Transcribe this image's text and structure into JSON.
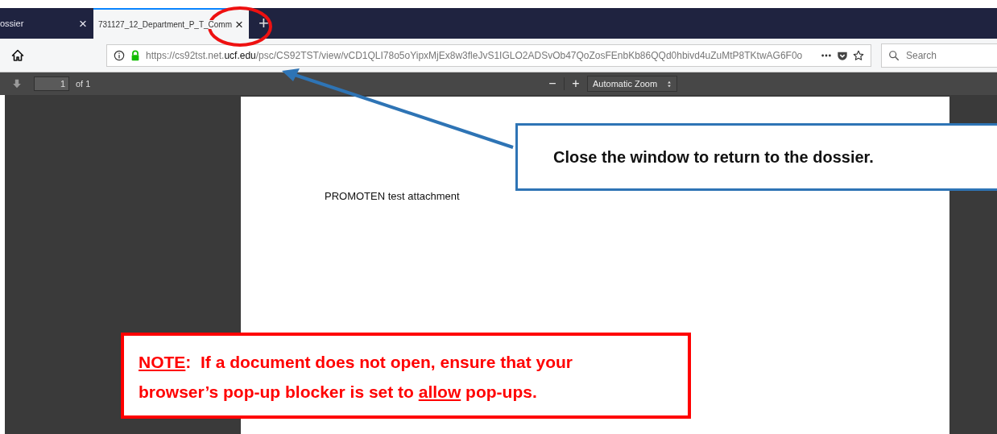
{
  "tabs": [
    {
      "label": "ossier",
      "selected": false,
      "close": "×"
    },
    {
      "label": "731127_12_Department_P_T_Comm",
      "selected": true,
      "close": "×"
    }
  ],
  "new_tab": "+",
  "address_bar": {
    "url_start": "https://cs92tst.net.",
    "url_domain": "ucf.edu",
    "url_path": "/psc/CS92TST/view/vCD1QLI78o5oYipxMjEx8w3fleJvS1IGLO2ADSvOb47QoZosFEnbKb86QQd0hbivd4uZuMtP8TKtwAG6F0o",
    "secure": true
  },
  "search": {
    "placeholder": "Search"
  },
  "pdf_toolbar": {
    "page_value": "1",
    "page_count": "of 1",
    "zoom_out": "−",
    "zoom_in": "+",
    "zoom": "Automatic Zoom"
  },
  "document": {
    "text": "PROMOTEN test attachment"
  },
  "callout": {
    "text": "Close the window to return to the dossier."
  },
  "note": {
    "segments": [
      {
        "text": "NOTE",
        "underline": true
      },
      {
        "text": ":  If a document does not open, ensure that your browser’s pop-up blocker is set to ",
        "underline": false
      },
      {
        "text": "allow",
        "underline": true
      },
      {
        "text": " pop-ups.",
        "underline": false
      }
    ]
  }
}
